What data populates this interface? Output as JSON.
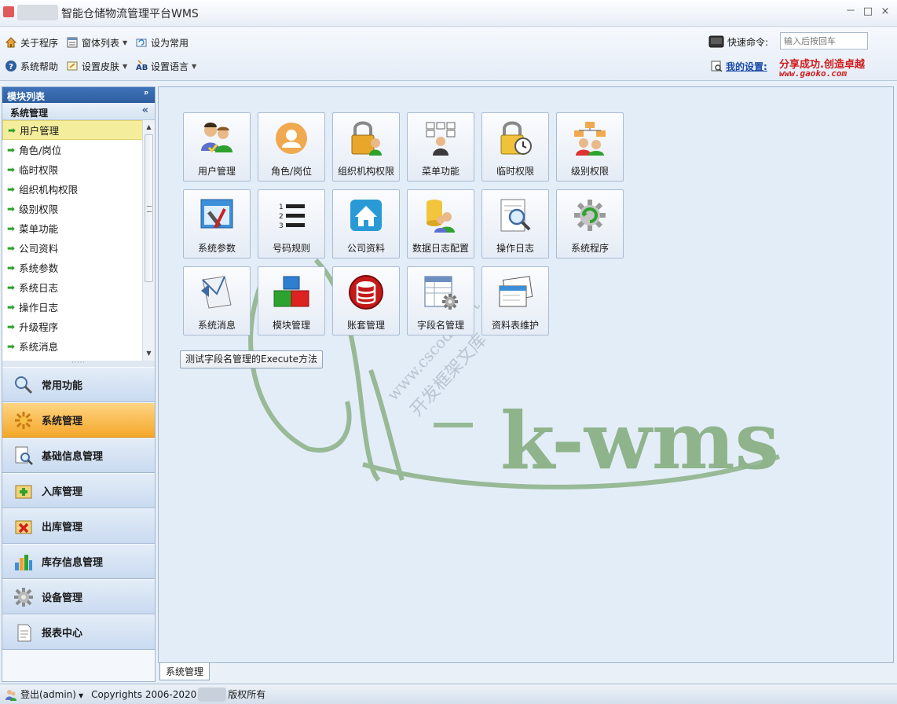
{
  "window": {
    "title": "智能仓储物流管理平台WMS",
    "minimize": "－",
    "maximize": "□",
    "close": "×"
  },
  "toolbar": {
    "about": "关于程序",
    "window_list": "窗体列表",
    "set_common": "设为常用",
    "help": "系统帮助",
    "skin": "设置皮肤",
    "language": "设置语言",
    "quick_cmd_label": "快速命令:",
    "quick_cmd_placeholder": "输入后按回车",
    "my_settings": "我的设置:",
    "slogan": "分享成功.创造卓越",
    "slogan_url": "www.gaoko.com"
  },
  "left_panel": {
    "header": "模块列表",
    "pin": "ᵖ",
    "section": "系统管理",
    "collapse": "«",
    "tree_items": [
      {
        "label": "用户管理"
      },
      {
        "label": "角色/岗位"
      },
      {
        "label": "临时权限"
      },
      {
        "label": "组织机构权限"
      },
      {
        "label": "级别权限"
      },
      {
        "label": "菜单功能"
      },
      {
        "label": "公司资料"
      },
      {
        "label": "系统参数"
      },
      {
        "label": "系统日志"
      },
      {
        "label": "操作日志"
      },
      {
        "label": "升级程序"
      },
      {
        "label": "系统消息"
      }
    ],
    "nav_buttons": [
      {
        "label": "常用功能",
        "icon": "magnifier-icon"
      },
      {
        "label": "系统管理",
        "icon": "gear-star-icon"
      },
      {
        "label": "基础信息管理",
        "icon": "document-search-icon"
      },
      {
        "label": "入库管理",
        "icon": "inbound-icon"
      },
      {
        "label": "出库管理",
        "icon": "outbound-icon"
      },
      {
        "label": "库存信息管理",
        "icon": "bar-chart-icon"
      },
      {
        "label": "设备管理",
        "icon": "cog-icon"
      },
      {
        "label": "报表中心",
        "icon": "report-icon"
      }
    ]
  },
  "main": {
    "tiles": [
      {
        "label": "用户管理",
        "icon": "users-icon"
      },
      {
        "label": "角色/岗位",
        "icon": "person-circle-icon"
      },
      {
        "label": "组织机构权限",
        "icon": "lock-users-icon"
      },
      {
        "label": "菜单功能",
        "icon": "menu-tree-icon"
      },
      {
        "label": "临时权限",
        "icon": "lock-clock-icon"
      },
      {
        "label": "级别权限",
        "icon": "level-tree-icon"
      },
      {
        "label": "系统参数",
        "icon": "tools-icon"
      },
      {
        "label": "号码规则",
        "icon": "numbered-list-icon"
      },
      {
        "label": "公司资料",
        "icon": "home-icon"
      },
      {
        "label": "数据日志配置",
        "icon": "database-users-icon"
      },
      {
        "label": "操作日志",
        "icon": "log-search-icon"
      },
      {
        "label": "系统程序",
        "icon": "refresh-gear-icon"
      },
      {
        "label": "系统消息",
        "icon": "envelope-icon"
      },
      {
        "label": "模块管理",
        "icon": "blocks-icon"
      },
      {
        "label": "账套管理",
        "icon": "database-red-icon"
      },
      {
        "label": "字段名管理",
        "icon": "table-gear-icon"
      },
      {
        "label": "资料表维护",
        "icon": "window-edit-icon"
      }
    ],
    "test_button": "测试字段名管理的Execute方法",
    "doc_tab": "系统管理",
    "watermark_logo": "k-wms",
    "watermark_site": "www.cscode.net",
    "watermark_tagline": "开发框架文库"
  },
  "statusbar": {
    "login": "登出(admin)",
    "copyright": "Copyrights 2006-2020",
    "copyright_tail": "版权所有"
  },
  "colors": {
    "accent_blue": "#2d5e9f",
    "active_orange": "#f4a72a",
    "watermark_green": "#8fb48c",
    "slogan_red": "#d01c1c"
  }
}
